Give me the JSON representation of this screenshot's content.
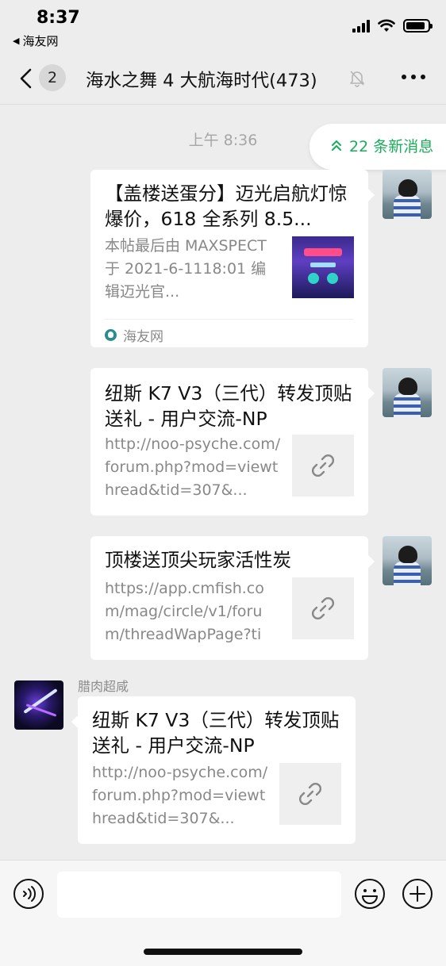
{
  "status_bar": {
    "time": "8:37",
    "back_app": "海友网",
    "battery_level": 0.9
  },
  "nav": {
    "back_badge": "2",
    "title": "海水之舞 4 大航海时代(473)",
    "mute_icon": "bell-slash-icon",
    "more_icon": "more-dots-icon"
  },
  "chat": {
    "timestamp": "上午 8:36",
    "new_messages": "22 条新消息",
    "sender_name": "腊肉超咸",
    "messages": [
      {
        "side": "right",
        "title": "【盖楼送蛋分】迈光启航灯惊爆价，618 全系列 8.5...",
        "description": "本帖最后由 MAXSPECT 于 2021-6-1118:01 编辑迈光官...",
        "thumbnail": "article-image",
        "source": "海友网"
      },
      {
        "side": "right",
        "title": "纽斯 K7 V3（三代）转发顶贴送礼 - 用户交流-NP",
        "description": "http://noo-psyche.com/forum.php?mod=viewthread&tid=307&...",
        "thumbnail": "link-icon"
      },
      {
        "side": "right",
        "title": "顶楼送顶尖玩家活性炭",
        "description": "https://app.cmfish.com/mag/circle/v1/forum/threadWapPage?tid...",
        "thumbnail": "link-icon"
      },
      {
        "side": "left",
        "title": "纽斯 K7 V3（三代）转发顶贴送礼 - 用户交流-NP",
        "description": "http://noo-psyche.com/forum.php?mod=viewthread&tid=307&...",
        "thumbnail": "link-icon"
      }
    ]
  },
  "input_bar": {
    "voice_icon": "voice-icon",
    "emoji_icon": "emoji-icon",
    "plus_icon": "plus-icon",
    "placeholder": ""
  }
}
